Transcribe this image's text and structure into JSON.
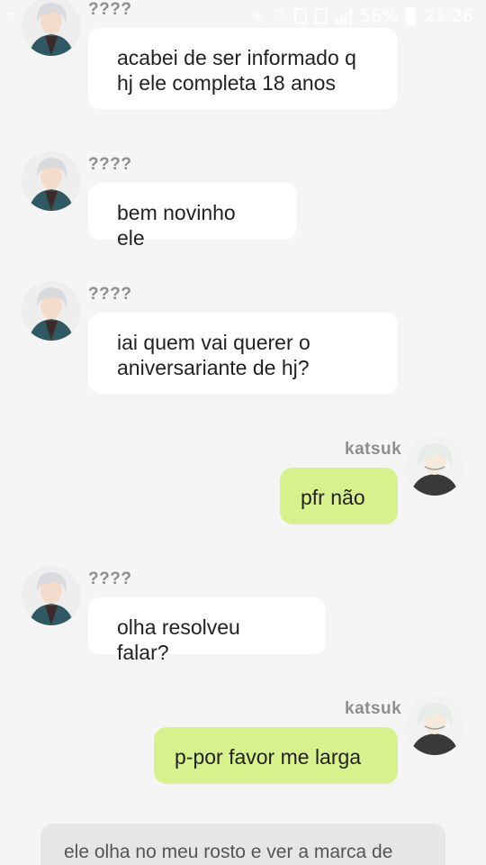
{
  "status_bar": {
    "battery_percent": "56%",
    "time": "21:26"
  },
  "messages": [
    {
      "sender": "????",
      "side": "left",
      "text": "acabei de ser informado q\nhj ele completa 18 anos"
    },
    {
      "sender": "????",
      "side": "left",
      "text": "bem novinho ele"
    },
    {
      "sender": "????",
      "side": "left",
      "text": "iai quem vai querer o\naniversariante de hj?"
    },
    {
      "sender": "katsuk",
      "side": "right",
      "text": "pfr não"
    },
    {
      "sender": "????",
      "side": "left",
      "text": "olha resolveu falar?"
    },
    {
      "sender": "katsuk",
      "side": "right",
      "text": "p-por favor me larga"
    }
  ],
  "narration": {
    "text": "ele olha no meu rosto e ver a marca de"
  },
  "colors": {
    "background": "#f5f5f5",
    "incoming_bubble": "#ffffff",
    "outgoing_bubble": "#d7f28c",
    "narration_bubble": "#e6e6e6",
    "sender_text": "#8e8e8e"
  }
}
